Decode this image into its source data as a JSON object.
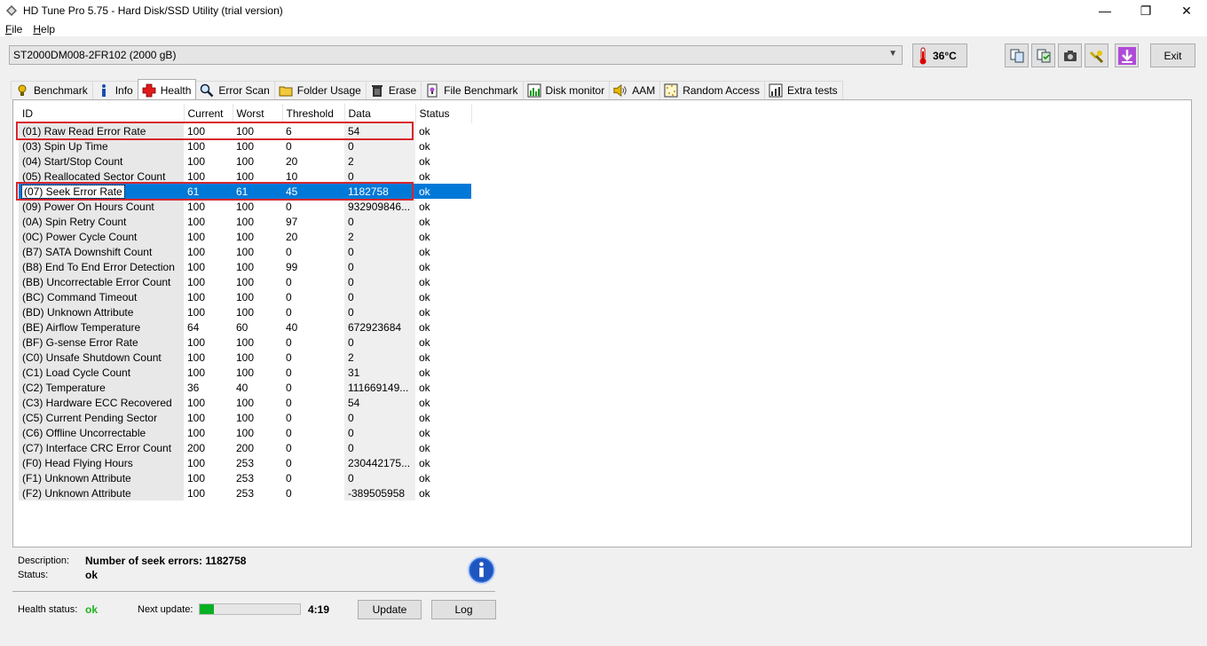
{
  "window": {
    "title": "HD Tune Pro 5.75 - Hard Disk/SSD Utility (trial version)",
    "minimize": "—",
    "maximize": "❐",
    "close": "✕"
  },
  "menu": [
    {
      "u": "F",
      "rest": "ile"
    },
    {
      "u": "H",
      "rest": "elp"
    }
  ],
  "toolbar": {
    "drive": "ST2000DM008-2FR102 (2000 gB)",
    "temperature": "36°C",
    "exit_label": "Exit"
  },
  "tabs": [
    {
      "label": "Benchmark",
      "icon": "benchmark-icon"
    },
    {
      "label": "Info",
      "icon": "info-icon"
    },
    {
      "label": "Health",
      "icon": "health-icon"
    },
    {
      "label": "Error Scan",
      "icon": "magnifier-icon"
    },
    {
      "label": "Folder Usage",
      "icon": "folder-icon"
    },
    {
      "label": "Erase",
      "icon": "trash-icon"
    },
    {
      "label": "File Benchmark",
      "icon": "file-benchmark-icon"
    },
    {
      "label": "Disk monitor",
      "icon": "monitor-icon"
    },
    {
      "label": "AAM",
      "icon": "speaker-icon"
    },
    {
      "label": "Random Access",
      "icon": "random-access-icon"
    },
    {
      "label": "Extra tests",
      "icon": "extra-tests-icon"
    }
  ],
  "active_tab": "Health",
  "columns": [
    "ID",
    "Current",
    "Worst",
    "Threshold",
    "Data",
    "Status"
  ],
  "rows": [
    [
      "(01) Raw Read Error Rate",
      "100",
      "100",
      "6",
      "54",
      "ok"
    ],
    [
      "(03) Spin Up Time",
      "100",
      "100",
      "0",
      "0",
      "ok"
    ],
    [
      "(04) Start/Stop Count",
      "100",
      "100",
      "20",
      "2",
      "ok"
    ],
    [
      "(05) Reallocated Sector Count",
      "100",
      "100",
      "10",
      "0",
      "ok"
    ],
    [
      "(07) Seek Error Rate",
      "61",
      "61",
      "45",
      "1182758",
      "ok"
    ],
    [
      "(09) Power On Hours Count",
      "100",
      "100",
      "0",
      "932909846...",
      "ok"
    ],
    [
      "(0A) Spin Retry Count",
      "100",
      "100",
      "97",
      "0",
      "ok"
    ],
    [
      "(0C) Power Cycle Count",
      "100",
      "100",
      "20",
      "2",
      "ok"
    ],
    [
      "(B7) SATA Downshift Count",
      "100",
      "100",
      "0",
      "0",
      "ok"
    ],
    [
      "(B8) End To End Error Detection",
      "100",
      "100",
      "99",
      "0",
      "ok"
    ],
    [
      "(BB) Uncorrectable Error Count",
      "100",
      "100",
      "0",
      "0",
      "ok"
    ],
    [
      "(BC) Command Timeout",
      "100",
      "100",
      "0",
      "0",
      "ok"
    ],
    [
      "(BD) Unknown Attribute",
      "100",
      "100",
      "0",
      "0",
      "ok"
    ],
    [
      "(BE) Airflow Temperature",
      "64",
      "60",
      "40",
      "672923684",
      "ok"
    ],
    [
      "(BF) G-sense Error Rate",
      "100",
      "100",
      "0",
      "0",
      "ok"
    ],
    [
      "(C0) Unsafe Shutdown Count",
      "100",
      "100",
      "0",
      "2",
      "ok"
    ],
    [
      "(C1) Load Cycle Count",
      "100",
      "100",
      "0",
      "31",
      "ok"
    ],
    [
      "(C2) Temperature",
      "36",
      "40",
      "0",
      "111669149...",
      "ok"
    ],
    [
      "(C3) Hardware ECC Recovered",
      "100",
      "100",
      "0",
      "54",
      "ok"
    ],
    [
      "(C5) Current Pending Sector",
      "100",
      "100",
      "0",
      "0",
      "ok"
    ],
    [
      "(C6) Offline Uncorrectable",
      "100",
      "100",
      "0",
      "0",
      "ok"
    ],
    [
      "(C7) Interface CRC Error Count",
      "200",
      "200",
      "0",
      "0",
      "ok"
    ],
    [
      "(F0) Head Flying Hours",
      "100",
      "253",
      "0",
      "230442175...",
      "ok"
    ],
    [
      "(F1) Unknown Attribute",
      "100",
      "253",
      "0",
      "0",
      "ok"
    ],
    [
      "(F2) Unknown Attribute",
      "100",
      "253",
      "0",
      "-389505958",
      "ok"
    ]
  ],
  "selected_row": 4,
  "highlighted_rows": [
    0,
    4
  ],
  "details": {
    "description_label": "Description:",
    "description": "Number of seek errors: 1182758",
    "status_label": "Status:",
    "status": "ok",
    "health_status_label": "Health status:",
    "health_status": "ok",
    "next_update_label": "Next update:",
    "next_update": "4:19",
    "progress": 0.14,
    "update_label": "Update",
    "log_label": "Log"
  },
  "colors": {
    "selection": "#0078d7",
    "highlight": "#d9262c",
    "ok_green": "#1fb41f",
    "progress_green": "#06b025"
  }
}
